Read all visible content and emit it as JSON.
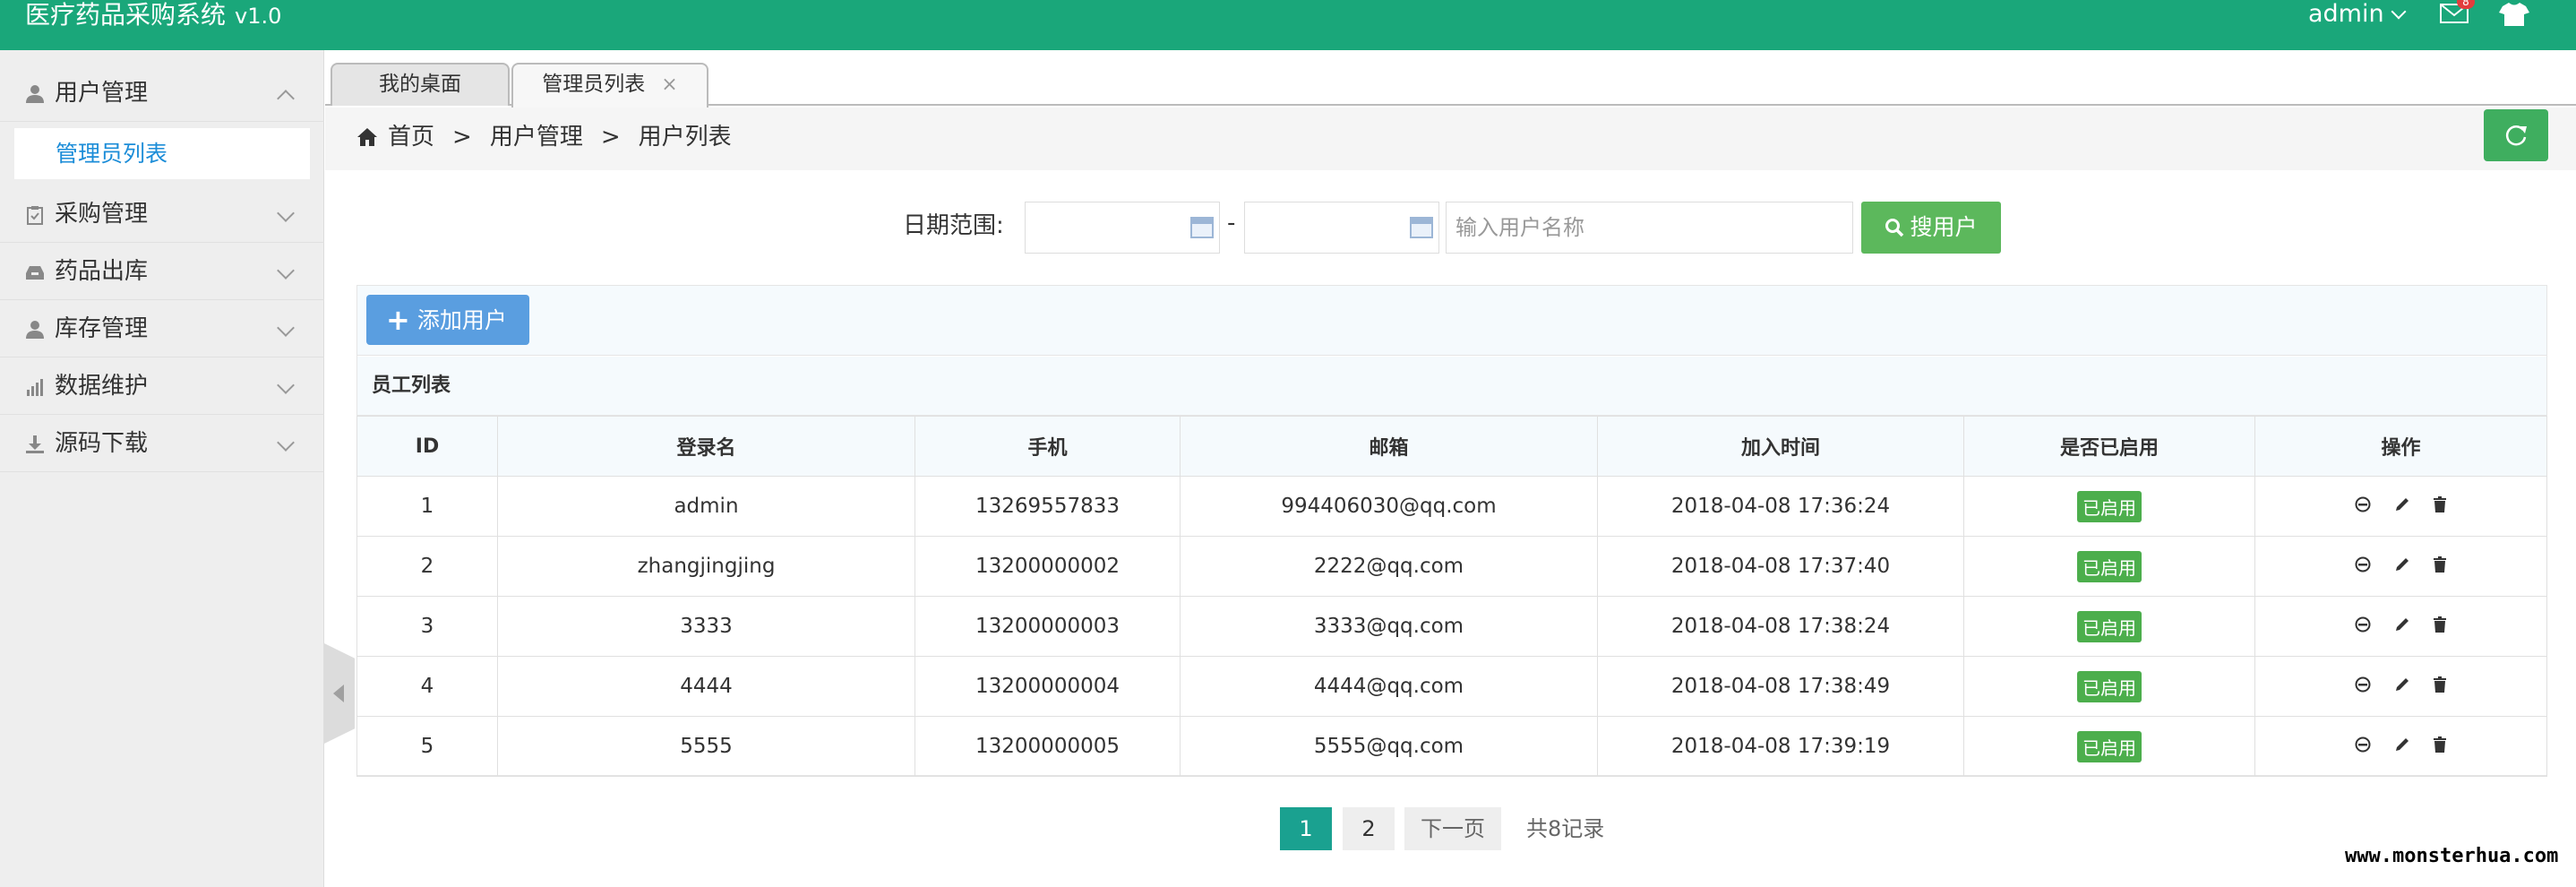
{
  "header": {
    "app_title": "医疗药品采购系统",
    "version": "v1.0",
    "username": "admin",
    "mail_badge": "8",
    "brand_color": "#1aa77a"
  },
  "sidebar": {
    "items": [
      {
        "label": "用户管理",
        "icon": "user-icon",
        "expanded": true
      },
      {
        "label": "采购管理",
        "icon": "clipboard-icon",
        "expanded": false
      },
      {
        "label": "药品出库",
        "icon": "inbox-icon",
        "expanded": false
      },
      {
        "label": "库存管理",
        "icon": "user-icon",
        "expanded": false
      },
      {
        "label": "数据维护",
        "icon": "bar-chart-icon",
        "expanded": false
      },
      {
        "label": "源码下载",
        "icon": "download-icon",
        "expanded": false
      }
    ],
    "sub_item": "管理员列表"
  },
  "tabs": [
    {
      "label": "我的桌面"
    },
    {
      "label": "管理员列表",
      "close": "×"
    }
  ],
  "breadcrumb": {
    "home": "首页",
    "sep": ">",
    "level1": "用户管理",
    "level2": "用户列表"
  },
  "search": {
    "date_label": "日期范围:",
    "dash": "-",
    "name_placeholder": "输入用户名称",
    "button": "搜用户"
  },
  "panel": {
    "add_button": "添加用户",
    "title": "员工列表"
  },
  "table": {
    "columns": [
      "ID",
      "登录名",
      "手机",
      "邮箱",
      "加入时间",
      "是否已启用",
      "操作"
    ],
    "rows": [
      {
        "id": "1",
        "login": "admin",
        "phone": "13269557833",
        "email": "994406030@qq.com",
        "joined": "2018-04-08 17:36:24",
        "status": "已启用"
      },
      {
        "id": "2",
        "login": "zhangjingjing",
        "phone": "13200000002",
        "email": "2222@qq.com",
        "joined": "2018-04-08 17:37:40",
        "status": "已启用"
      },
      {
        "id": "3",
        "login": "3333",
        "phone": "13200000003",
        "email": "3333@qq.com",
        "joined": "2018-04-08 17:38:24",
        "status": "已启用"
      },
      {
        "id": "4",
        "login": "4444",
        "phone": "13200000004",
        "email": "4444@qq.com",
        "joined": "2018-04-08 17:38:49",
        "status": "已启用"
      },
      {
        "id": "5",
        "login": "5555",
        "phone": "13200000005",
        "email": "5555@qq.com",
        "joined": "2018-04-08 17:39:19",
        "status": "已启用"
      }
    ]
  },
  "pagination": {
    "page1": "1",
    "page2": "2",
    "next": "下一页",
    "total": "共8记录"
  },
  "watermark": "www.monsterhua.com"
}
